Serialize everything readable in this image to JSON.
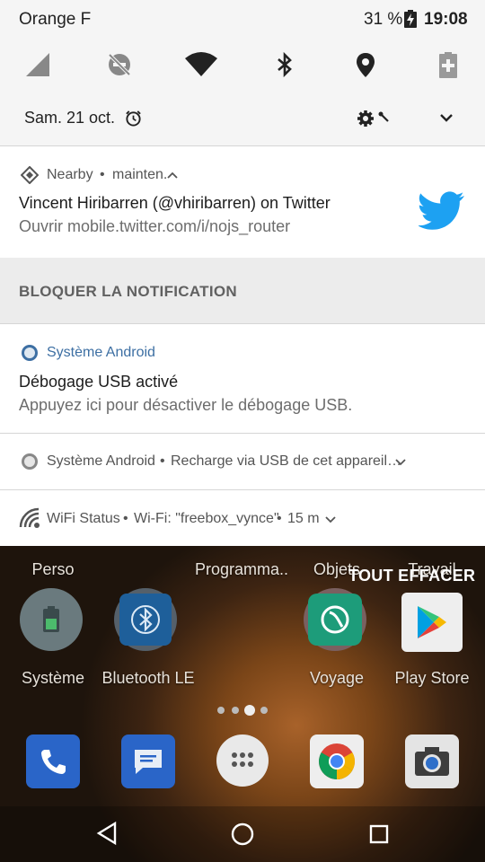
{
  "status_bar": {
    "carrier": "Orange F",
    "battery": "31 %",
    "time": "19:08"
  },
  "quick_settings": {
    "date": "Sam. 21 oct.",
    "icons": [
      "signal-icon",
      "dnd-off-icon",
      "wifi-icon",
      "bluetooth-icon",
      "location-icon",
      "battery-saver-icon"
    ]
  },
  "notifications": {
    "twitter": {
      "app": "Nearby",
      "time": "mainten.",
      "title": "Vincent Hiribarren (@vhiribarren) on Twitter",
      "body": "Ouvrir mobile.twitter.com/i/nojs_router",
      "block_label": "BLOQUER LA NOTIFICATION"
    },
    "usb_debug": {
      "app": "Système Android",
      "title": "Débogage USB activé",
      "body": "Appuyez ici pour désactiver le débogage USB."
    },
    "usb_charge": {
      "app": "Système Android",
      "text": "Recharge via USB de cet appareil…"
    },
    "wifi_status": {
      "app": "WiFi Status",
      "text": "Wi-Fi: \"freebox_vynce\"",
      "time": "15 m"
    }
  },
  "clear_all_label": "TOUT EFFACER",
  "home": {
    "top_labels": [
      "Perso",
      "Programma..",
      "Objets",
      "Travail"
    ],
    "apps": [
      "Système",
      "Bluetooth LE",
      "Voyage",
      "Play Store"
    ]
  },
  "colors": {
    "twitter_blue": "#1da1f2",
    "android_blue": "#3d6fa3"
  }
}
